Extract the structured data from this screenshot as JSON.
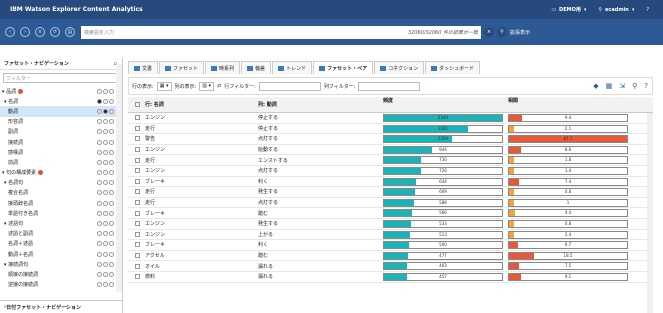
{
  "app": {
    "title": "IBM Watson Explorer Content Analytics",
    "collection": "DEMO用",
    "user": "ecadmin",
    "help": "?"
  },
  "search": {
    "placeholder": "検索語を入力",
    "count": "32060/32060 件の結果が一致",
    "advanced": "拡張表示"
  },
  "colors": {
    "header": "#264a7e",
    "searchbar": "#2d5a94",
    "freq": "#1ab4b8",
    "corrLow": "#f2a33a",
    "corrHigh": "#e65a3a"
  },
  "left": {
    "title": "ファセット・ナビゲーション",
    "filter": "フィルター",
    "footer": "日付ファセット・ナビゲーション",
    "items": [
      "品詞",
      "名詞",
      "動詞",
      "形容詞",
      "副詞",
      "接続詞",
      "感嘆詞",
      "前詞",
      "句の構成要素",
      "名詞句",
      "複合名詞",
      "接頭辞名詞",
      "単語付き名詞",
      "述語句",
      "述語と副詞",
      "名詞＋述語",
      "動詞＋名詞",
      "接続詞句",
      "順接の接続詞",
      "逆接の接続詞"
    ]
  },
  "tabs": [
    "文書",
    "ファセット",
    "時系列",
    "偏差",
    "トレンド",
    "ファセット・ペア",
    "コネクション",
    "ダッシュボード"
  ],
  "toolbar": {
    "row_label": "行の表示:",
    "col_label": "列の表示:",
    "row_filter": "行フィルター:",
    "col_filter": "列フィルター:"
  },
  "grid": {
    "col1": "行: 名詞",
    "col2": "列: 動詞",
    "col3": "頻度",
    "col4": "相関"
  },
  "chart_data": {
    "type": "table",
    "rows": [
      {
        "noun": "エンジン",
        "verb": "停止する",
        "freq": 2344,
        "corr": 9.4
      },
      {
        "noun": "走行",
        "verb": "停止する",
        "freq": 1661,
        "corr": 2.1
      },
      {
        "noun": "警告",
        "verb": "点灯する",
        "freq": 1359,
        "corr": 87.7
      },
      {
        "noun": "エンジン",
        "verb": "始動する",
        "freq": 944,
        "corr": 8.6
      },
      {
        "noun": "走行",
        "verb": "エンストする",
        "freq": 730,
        "corr": 1.8
      },
      {
        "noun": "エンジン",
        "verb": "点灯する",
        "freq": 726,
        "corr": 1.4
      },
      {
        "noun": "ブレーキ",
        "verb": "利く",
        "freq": 644,
        "corr": 7.4
      },
      {
        "noun": "走行",
        "verb": "発生する",
        "freq": 609,
        "corr": 0.8
      },
      {
        "noun": "走行",
        "verb": "点灯する",
        "freq": 588,
        "corr": 1.0
      },
      {
        "noun": "ブレーキ",
        "verb": "踏む",
        "freq": 566,
        "corr": 4.4
      },
      {
        "noun": "エンジン",
        "verb": "発生する",
        "freq": 533,
        "corr": 0.8
      },
      {
        "noun": "エンジン",
        "verb": "上がる",
        "freq": 513,
        "corr": 2.4
      },
      {
        "noun": "ブレーキ",
        "verb": "利く",
        "freq": 500,
        "corr": 6.7
      },
      {
        "noun": "アクセル",
        "verb": "踏む",
        "freq": 477,
        "corr": 18.5
      },
      {
        "noun": "オイル",
        "verb": "漏れる",
        "freq": 463,
        "corr": 7.5
      },
      {
        "noun": "燃料",
        "verb": "漏れる",
        "freq": 457,
        "corr": 9.1
      }
    ]
  }
}
